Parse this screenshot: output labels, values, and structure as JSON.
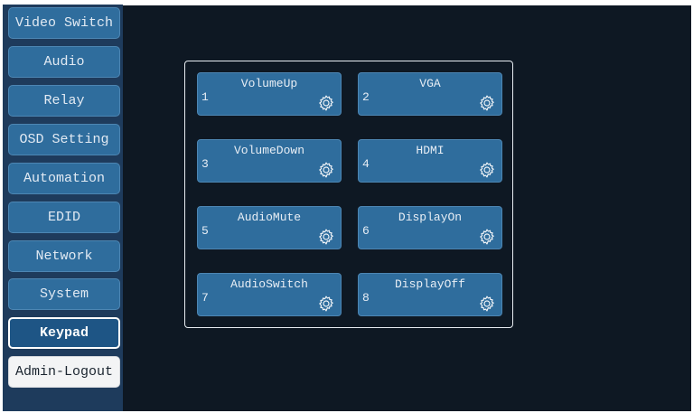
{
  "sidebar": {
    "items": [
      {
        "label": "Video Switch"
      },
      {
        "label": "Audio"
      },
      {
        "label": "Relay"
      },
      {
        "label": "OSD Setting"
      },
      {
        "label": "Automation"
      },
      {
        "label": "EDID"
      },
      {
        "label": "Network"
      },
      {
        "label": "System"
      },
      {
        "label": "Keypad",
        "active": true
      },
      {
        "label": "Admin-Logout"
      }
    ]
  },
  "keypad": {
    "keys": [
      {
        "number": "1",
        "label": "VolumeUp"
      },
      {
        "number": "2",
        "label": "VGA"
      },
      {
        "number": "3",
        "label": "VolumeDown"
      },
      {
        "number": "4",
        "label": "HDMI"
      },
      {
        "number": "5",
        "label": "AudioMute"
      },
      {
        "number": "6",
        "label": "DisplayOn"
      },
      {
        "number": "7",
        "label": "AudioSwitch"
      },
      {
        "number": "8",
        "label": "DisplayOff"
      }
    ],
    "settings_icon": "gear-icon"
  },
  "colors": {
    "sidebar_bg": "#1e3b5c",
    "main_bg": "#0e1823",
    "button_bg": "#2f6d9d",
    "active_border": "#ffffff"
  }
}
